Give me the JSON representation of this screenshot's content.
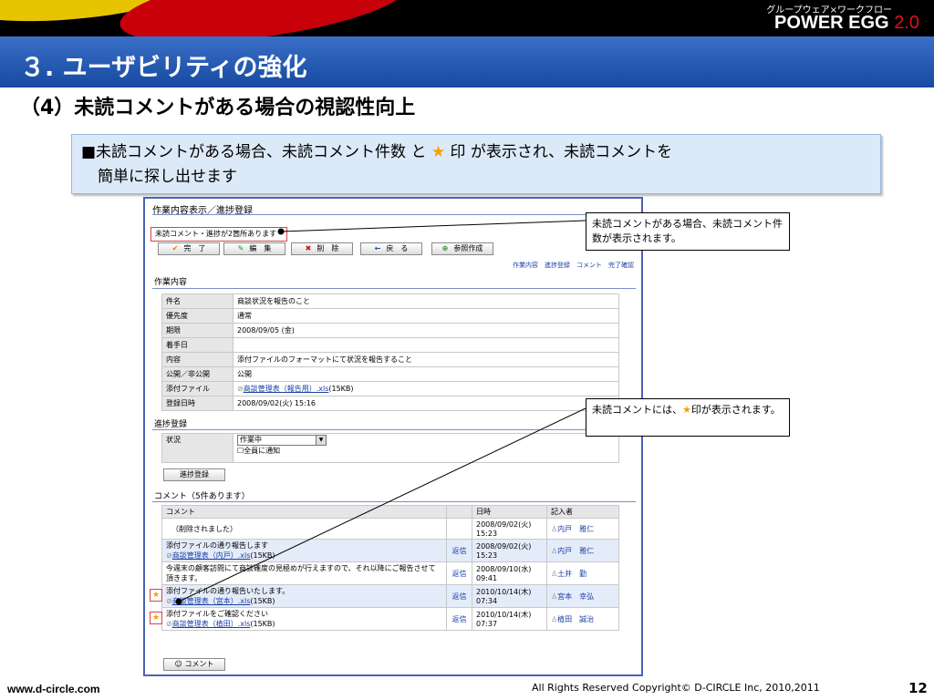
{
  "header": {
    "brand_sub": "グループウェア×ワークフロー",
    "brand_name": "POWER EGG",
    "brand_version": "2.0"
  },
  "slide": {
    "title": "３. ユーザビリティの強化",
    "subtitle": "（4）未読コメントがある場合の視認性向上",
    "note_part1": "■未読コメントがある場合、未読コメント件数 と",
    "note_star": "★",
    "note_part2": "印 が表示され、未読コメントを",
    "note_line2": "簡単に探し出せます"
  },
  "screen": {
    "panel_title": "作業内容表示／進捗登録",
    "unread_notice": "未読コメント・進捗が2箇所あります",
    "buttons": [
      {
        "icon": "✔",
        "label": "完　了"
      },
      {
        "icon": "✎",
        "label": "編　集"
      },
      {
        "icon": "✖",
        "label": "削　除"
      },
      {
        "icon": "←",
        "label": "戻　る"
      },
      {
        "icon": "⊕",
        "label": "参照作成"
      }
    ],
    "top_links": "作業内容　進捗登録　コメント　完了確認",
    "work_section": "作業内容",
    "work_rows": [
      {
        "k": "件名",
        "v": "商談状況を報告のこと"
      },
      {
        "k": "優先度",
        "v": "通常"
      },
      {
        "k": "期限",
        "v": "2008/09/05 (金)"
      },
      {
        "k": "着手日",
        "v": ""
      },
      {
        "k": "内容",
        "v": "添付ファイルのフォーマットにて状況を報告すること"
      },
      {
        "k": "公開／非公開",
        "v": "公開"
      },
      {
        "k": "添付ファイル",
        "v": "商談管理表（報告用）.xls",
        "size": "(15KB)"
      },
      {
        "k": "登録日時",
        "v": "2008/09/02(火) 15:16"
      }
    ],
    "progress_section": "進捗登録",
    "progress_status_label": "状況",
    "progress_status_value": "作業中",
    "progress_notify": "全員に通知",
    "progress_button": "進捗登録",
    "comment_section": "コメント（5件あります）",
    "comment_headers": {
      "comment": "コメント",
      "date": "日時",
      "author": "記入者"
    },
    "comments": [
      {
        "text1": "（削除されました）",
        "link": "",
        "size": "",
        "reply": "",
        "date1": "2008/09/02(火)",
        "date2": "15:23",
        "author": "内戸　雅仁",
        "star": false
      },
      {
        "text1": "添付ファイルの通り報告します",
        "link": "商談管理表（内戸）.xls",
        "size": "(15KB)",
        "reply": "返信",
        "date1": "2008/09/02(火)",
        "date2": "15:23",
        "author": "内戸　雅仁",
        "star": false
      },
      {
        "text1": "今週末の顧客訪問にて商談確度の見極めが行えますので、それ以降にご報告させて頂きます。",
        "link": "",
        "size": "",
        "reply": "返信",
        "date1": "2008/09/10(水)",
        "date2": "09:41",
        "author": "土井　勤",
        "star": false
      },
      {
        "text1": "添付ファイルの通り報告いたします。",
        "link": "商談管理表（宮本）.xls",
        "size": "(15KB)",
        "reply": "返信",
        "date1": "2010/10/14(木)",
        "date2": "07:34",
        "author": "宮本　幸弘",
        "star": true
      },
      {
        "text1": "添付ファイルをご確認ください",
        "link": "商談管理表（植田）.xls",
        "size": "(15KB)",
        "reply": "返信",
        "date1": "2010/10/14(木)",
        "date2": "07:37",
        "author": "植田　誠治",
        "star": true
      }
    ],
    "comment_button": "コメント"
  },
  "callouts": {
    "c1": "未読コメントがある場合、未読コメント件数が表示されます。",
    "c2_part1": "未読コメントには、",
    "c2_star": "★",
    "c2_part2": "印が表示されます。"
  },
  "footer": {
    "url": "www.d-circle.com",
    "copyright": "All Rights Reserved Copyright© D-CIRCLE  Inc, 2010,2011",
    "page": "12"
  },
  "colors": {
    "title_bar": "#174aa0",
    "star": "#f5a000",
    "brand_version": "#e0101a"
  }
}
